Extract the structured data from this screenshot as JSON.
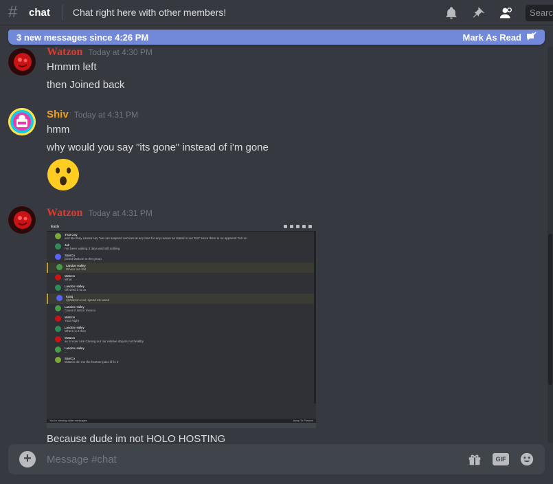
{
  "header": {
    "channel": "chat",
    "topic": "Chat right here with other members!",
    "search_placeholder": "Search"
  },
  "new_messages_bar": {
    "text": "3 new messages since 4:26 PM",
    "mark_as_read": "Mark As Read"
  },
  "messages": [
    {
      "author": "Watzon",
      "timestamp": "Today at 4:30 PM",
      "lines": [
        "Hmmm left",
        "then Joined back"
      ]
    },
    {
      "author": "Shiv",
      "timestamp": "Today at 4:31 PM",
      "lines": [
        "hmm",
        "why would you say \"its gone\" instead of i'm gone"
      ],
      "emoji": "hushed-face"
    },
    {
      "author": "Watzon",
      "timestamp": "Today at 4:31 PM",
      "attachment": {
        "title": "Easly",
        "rows": [
          {
            "name": "That Guy",
            "text": "and btw they cannot say \"we can suspend services at any time for any reason as stated in our ToS\" since there is no apparent ToS on"
          },
          {
            "name": "Jak",
            "text": "I've been waiting 3 days and still nothing"
          },
          {
            "name": "SamCo",
            "text": "joined Watzon to the group"
          },
          {
            "name": "Landon Halley",
            "text": "Where our shit",
            "highlight": true
          },
          {
            "name": "Watzon",
            "text": "What"
          },
          {
            "name": "Landon Halley",
            "text": "Ok send it to us"
          },
          {
            "name": "Katiq",
            "text": "@Watzon cool, speed etc weed",
            "highlight": true
          },
          {
            "name": "Landon Halley",
            "text": "Cause it isnt in mexico"
          },
          {
            "name": "Watzon",
            "text": "Your Right"
          },
          {
            "name": "Landon Halley",
            "text": "Where is it then"
          },
          {
            "name": "Watzon",
            "text": "as of now I am Closing out our relative ship its not healthy"
          },
          {
            "name": "Landon Halley",
            "text": "..."
          },
          {
            "name": "SamCo",
            "text": "Watzon dm me the hetzner pass ill fix it"
          }
        ],
        "footer_left": "You're viewing older messages",
        "footer_right": "Jump To Present"
      },
      "lines": [
        "Because dude im not HOLO HOSTING"
      ]
    }
  ],
  "composer": {
    "placeholder": "Message #chat"
  },
  "colors": {
    "background": "#36393f",
    "accent": "#7289da",
    "watzon": "#e03a2f",
    "shiv": "#f0a020"
  }
}
